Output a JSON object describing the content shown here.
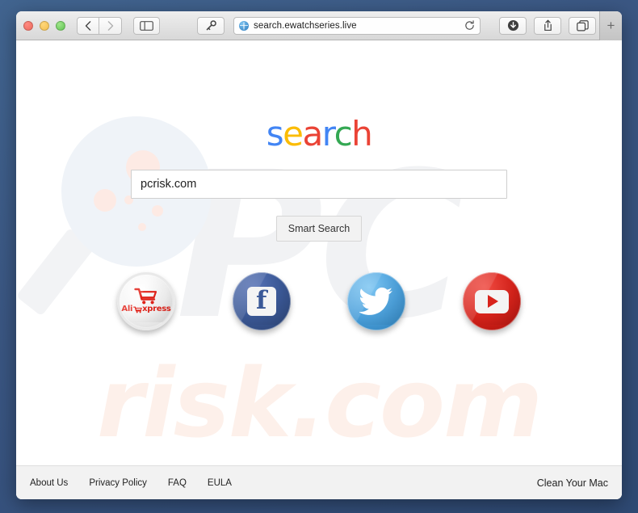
{
  "browser": {
    "traffic_lights": [
      "close",
      "minimize",
      "zoom"
    ],
    "back_label": "‹",
    "forward_label": "›",
    "sidebar_icon": "sidebar-icon",
    "key_icon": "key-icon",
    "address": {
      "url": "search.ewatchseries.live",
      "site_icon": "globe-icon",
      "reload_glyph": "↻"
    },
    "downloads_glyph": "↓",
    "share_glyph": "⇧",
    "tabs_glyph": "⧉",
    "new_tab_glyph": "+"
  },
  "page": {
    "watermark_pc": "PC",
    "watermark_risk": "risk.com",
    "logo": {
      "letters": [
        {
          "char": "s",
          "color": "#4285F4"
        },
        {
          "char": "e",
          "color": "#FBBC05"
        },
        {
          "char": "a",
          "color": "#EA4335"
        },
        {
          "char": "r",
          "color": "#4285F4"
        },
        {
          "char": "c",
          "color": "#34A853"
        },
        {
          "char": "h",
          "color": "#EA4335"
        }
      ],
      "text": "search"
    },
    "search": {
      "value": "pcrisk.com",
      "placeholder": "",
      "button_label": "Smart Search"
    },
    "shortcuts": [
      {
        "name": "aliexpress",
        "label": "AliExpress",
        "word_ali": "Ali",
        "word_xpress": "xpress",
        "color": "#e2231a"
      },
      {
        "name": "facebook",
        "label": "Facebook",
        "glyph": "f",
        "color": "#3b5998"
      },
      {
        "name": "twitter",
        "label": "Twitter",
        "glyph": "bird",
        "color": "#55acee"
      },
      {
        "name": "youtube",
        "label": "YouTube",
        "glyph": "play",
        "color": "#d8231b"
      }
    ],
    "footer": {
      "links": [
        "About Us",
        "Privacy Policy",
        "FAQ",
        "EULA"
      ],
      "promo": "Clean Your Mac"
    }
  }
}
